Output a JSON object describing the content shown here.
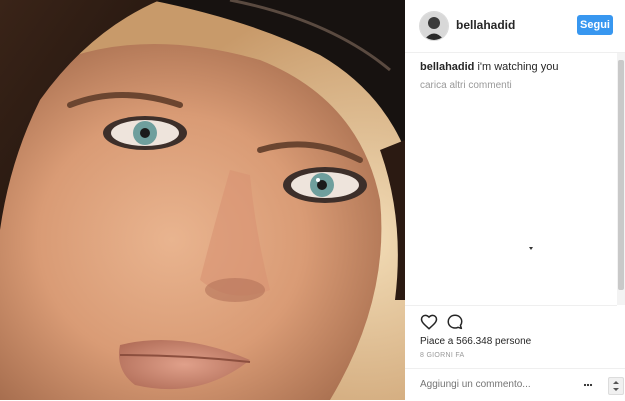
{
  "post": {
    "photo_alt": "close-up portrait photo"
  },
  "header": {
    "username": "bellahadid",
    "follow_label": "Segui"
  },
  "comments": {
    "first_author": "bellahadid",
    "first_text": "i'm watching you",
    "load_more": "carica altri commenti"
  },
  "stats": {
    "likes": "Piace a 566.348 persone",
    "timestamp": "8 GIORNI FA"
  },
  "composer": {
    "placeholder": "Aggiungi un commento..."
  },
  "colors": {
    "follow_button": "#3897f0",
    "muted_text": "#999999"
  },
  "icons": [
    "heart-icon",
    "comment-bubble-icon",
    "more-options-icon"
  ]
}
